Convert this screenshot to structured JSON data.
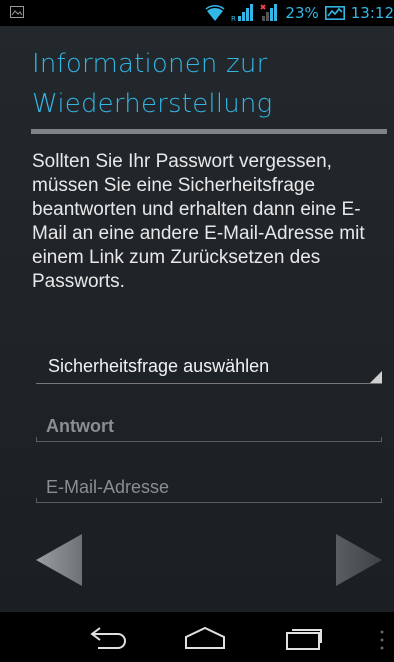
{
  "status_bar": {
    "battery_percent": "23%",
    "time": "13:12"
  },
  "page": {
    "title_line1": "Informationen zur",
    "title_line2": "Wiederherstellung",
    "description": "Sollten Sie Ihr Passwort vergessen, müssen Sie eine Sicherheitsfrage beantworten und erhalten dann eine E-Mail an eine andere E-Mail-Adresse mit einem Link zum Zurücksetzen des Passworts."
  },
  "form": {
    "security_question_label": "Sicherheitsfrage auswählen",
    "answer_placeholder": "Antwort",
    "answer_value": "",
    "email_placeholder": "E-Mail-Adresse",
    "email_value": ""
  },
  "icons": {
    "notification": "image-icon",
    "wifi": "wifi-icon",
    "signal_1": "signal-icon",
    "signal_2": "no-signal-icon",
    "battery": "battery-icon",
    "back_arrow": "back-arrow-icon",
    "next_arrow": "next-arrow-icon",
    "system_back": "back-icon",
    "system_home": "home-icon",
    "system_recent": "recent-apps-icon",
    "system_menu": "menu-icon"
  },
  "colors": {
    "accent": "#33b5e5",
    "background": "#1f2428",
    "text": "#e8e8e8",
    "divider": "#7f8388"
  }
}
